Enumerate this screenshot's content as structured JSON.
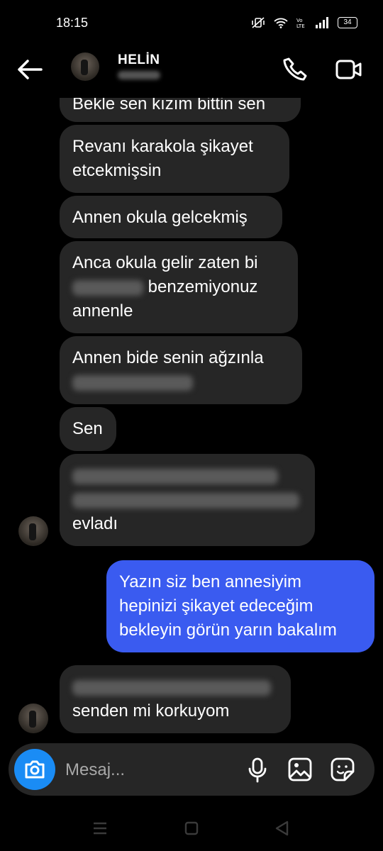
{
  "status": {
    "time": "18:15",
    "battery": "34"
  },
  "header": {
    "contact_name": "HELİN"
  },
  "messages": [
    {
      "side": "in",
      "text": "Bekle sen kızım bittin sen"
    },
    {
      "side": "in",
      "text_line1": "Revanı karakola şikayet",
      "text_line2": "etcekmişsin"
    },
    {
      "side": "in",
      "text": "Annen okula gelcekmiş"
    },
    {
      "side": "in",
      "text_line1": "Anca okula gelir zaten bi",
      "text_line2_tail": "benzemiyonuz",
      "text_line3": "annenle"
    },
    {
      "side": "in",
      "text_line1": "Annen bide senin ağzınla"
    },
    {
      "side": "in",
      "text": "Sen"
    },
    {
      "side": "in",
      "text_line3": "evladı"
    },
    {
      "side": "out",
      "text_line1": "Yazın siz ben annesiyim",
      "text_line2": "hepinizi şikayet edeceğim",
      "text_line3": "bekleyin görün yarın bakalım"
    },
    {
      "side": "in",
      "text_line2": "senden mi korkuyom"
    }
  ],
  "composer": {
    "placeholder": "Mesaj..."
  },
  "colors": {
    "incoming_bubble": "#262626",
    "outgoing_bubble": "#3a5bf0",
    "camera_button": "#1a8cf5"
  },
  "icons": {
    "back": "arrow-left-icon",
    "call": "phone-icon",
    "video": "video-camera-icon",
    "camera": "camera-icon",
    "mic": "microphone-icon",
    "gallery": "image-icon",
    "sticker": "sticker-icon"
  }
}
